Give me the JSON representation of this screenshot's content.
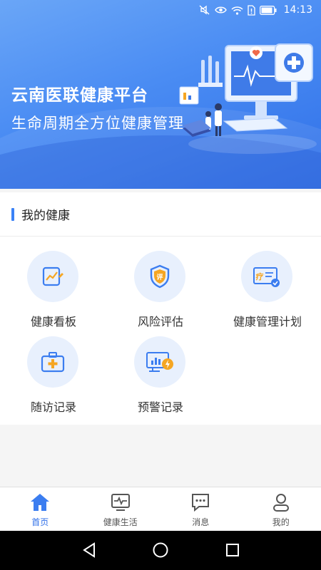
{
  "status_bar": {
    "time": "14:13",
    "icons": [
      "mute-icon",
      "eye-icon",
      "wifi-icon",
      "sim-alert-icon",
      "battery-icon"
    ]
  },
  "banner": {
    "title": "云南医联健康平台",
    "subtitle": "生命周期全方位健康管理"
  },
  "section": {
    "title": "我的健康",
    "items": [
      {
        "label": "健康看板",
        "icon": "chart-board-icon"
      },
      {
        "label": "风险评估",
        "icon": "shield-evaluate-icon"
      },
      {
        "label": "健康管理计划",
        "icon": "treatment-plan-icon"
      },
      {
        "label": "随访记录",
        "icon": "medical-kit-icon"
      },
      {
        "label": "预警记录",
        "icon": "monitor-alert-icon"
      }
    ]
  },
  "tabbar": {
    "tabs": [
      {
        "label": "首页",
        "icon": "home-icon",
        "active": true
      },
      {
        "label": "健康生活",
        "icon": "heartbeat-monitor-icon",
        "active": false
      },
      {
        "label": "消息",
        "icon": "message-icon",
        "active": false
      },
      {
        "label": "我的",
        "icon": "user-icon",
        "active": false
      }
    ]
  },
  "colors": {
    "accent": "#2f6fe8",
    "icon_blue": "#3b7df0",
    "icon_orange": "#f5a623",
    "icon_bg": "#e8f0fd"
  }
}
